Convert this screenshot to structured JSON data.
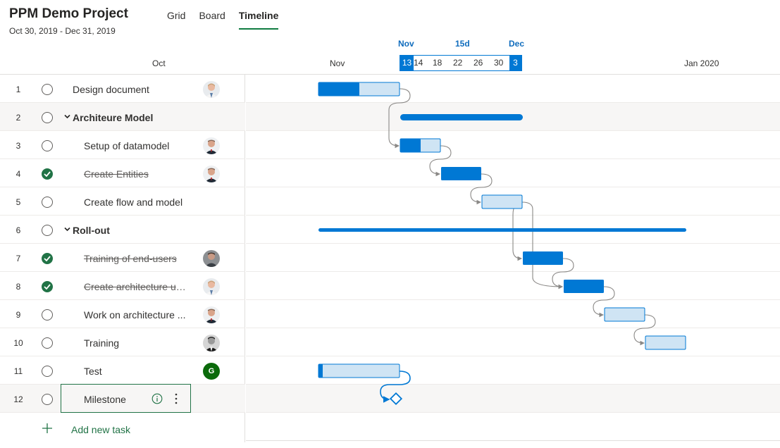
{
  "project": {
    "title": "PPM Demo Project",
    "date_range": "Oct 30, 2019 - Dec 31, 2019"
  },
  "tabs": [
    {
      "label": "Grid",
      "active": false
    },
    {
      "label": "Board",
      "active": false
    },
    {
      "label": "Timeline",
      "active": true
    }
  ],
  "timeline_header": {
    "months": [
      "Oct",
      "Nov",
      "Jan 2020"
    ],
    "zoom_labels": {
      "start": "Nov",
      "middle": "15d",
      "end": "Dec"
    },
    "zoom_start_day": "13",
    "zoom_end_day": "3",
    "zoom_ticks": [
      "14",
      "18",
      "22",
      "26",
      "30"
    ]
  },
  "tasks": [
    {
      "num": "1",
      "name": "Design document",
      "type": "task",
      "completed": false,
      "avatar": "person-light"
    },
    {
      "num": "2",
      "name": "Architeure Model",
      "type": "group",
      "completed": false,
      "avatar": null
    },
    {
      "num": "3",
      "name": "Setup of datamodel",
      "type": "task",
      "completed": false,
      "avatar": "person-dark"
    },
    {
      "num": "4",
      "name": "Create Entities",
      "type": "task",
      "completed": true,
      "avatar": "person-dark"
    },
    {
      "num": "5",
      "name": "Create flow and model",
      "type": "task",
      "completed": false,
      "avatar": null
    },
    {
      "num": "6",
      "name": "Roll-out",
      "type": "group",
      "completed": false,
      "avatar": null
    },
    {
      "num": "7",
      "name": "Training of end-users",
      "type": "task",
      "completed": true,
      "avatar": "person-gray"
    },
    {
      "num": "8",
      "name": "Create architecture up...",
      "type": "task",
      "completed": true,
      "avatar": "person-light"
    },
    {
      "num": "9",
      "name": "Work on architecture ...",
      "type": "task",
      "completed": false,
      "avatar": "person-dark"
    },
    {
      "num": "10",
      "name": "Training",
      "type": "task",
      "completed": false,
      "avatar": "person-bw"
    },
    {
      "num": "11",
      "name": "Test",
      "type": "task",
      "completed": false,
      "avatar": "G"
    },
    {
      "num": "12",
      "name": "Milestone",
      "type": "milestone",
      "completed": false,
      "avatar": null,
      "selected": true
    }
  ],
  "add_task_label": "Add new task",
  "colors": {
    "accent_green": "#217346",
    "bar_blue": "#0078d4",
    "bar_light": "#cfe4f4",
    "connector": "#8a8886"
  },
  "icons": {
    "complete": "checkmark-circle-icon",
    "incomplete": "empty-circle-icon",
    "expand": "chevron-down-icon",
    "info": "info-icon",
    "more": "more-vertical-icon",
    "add": "plus-icon"
  }
}
